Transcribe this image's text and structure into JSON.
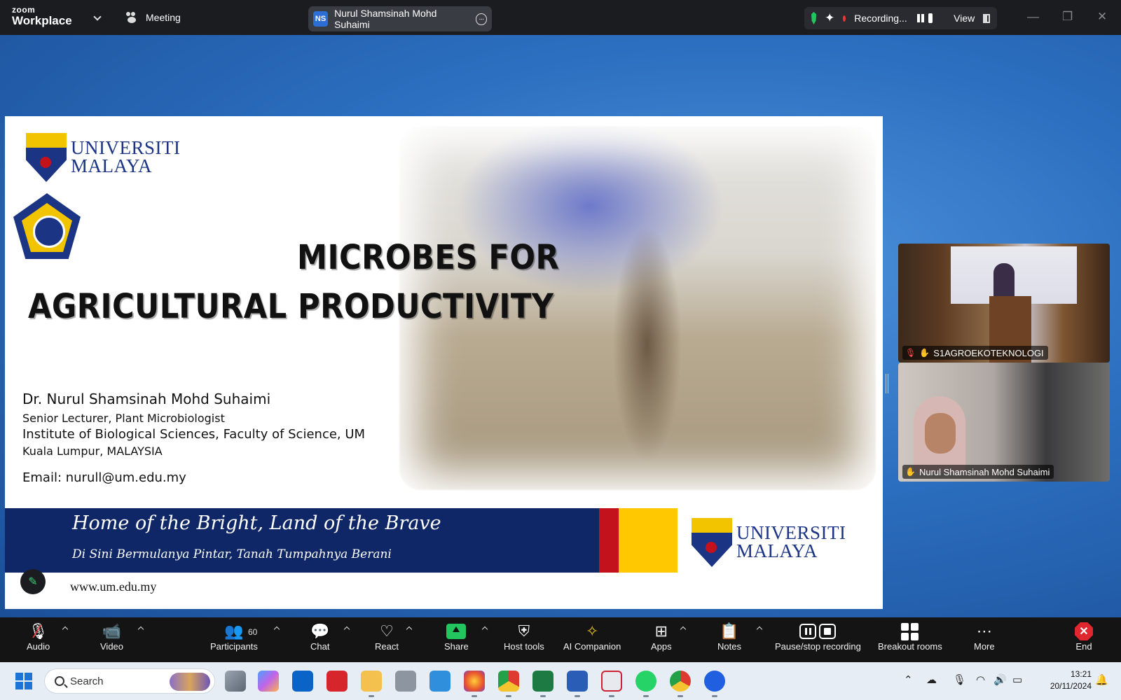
{
  "titlebar": {
    "brand_top": "zoom",
    "brand_bottom": "Workplace",
    "meeting_label": "Meeting",
    "active_speaker_initials": "NS",
    "active_speaker_name": "Nurul Shamsinah Mohd Suhaimi",
    "recording_label": "Recording...",
    "view_label": "View"
  },
  "slide": {
    "logo_line1": "UNIVERSITI",
    "logo_line2": "MALAYA",
    "title_line1": "MICROBES FOR",
    "title_line2": "AGRICULTURAL PRODUCTIVITY",
    "presenter_name": "Dr. Nurul Shamsinah Mohd Suhaimi",
    "presenter_role": "Senior Lecturer, Plant Microbiologist",
    "presenter_institute": "Institute of Biological Sciences, Faculty of Science, UM",
    "presenter_location": "Kuala Lumpur, MALAYSIA",
    "presenter_email": "Email: nurull@um.edu.my",
    "motto_en": "Home of the Bright, Land of the Brave",
    "motto_ms": "Di Sini Bermulanya Pintar, Tanah Tumpahnya Berani",
    "website": "www.um.edu.my",
    "colors": {
      "navy": "#0f2766",
      "red": "#c4121c",
      "yellow": "#ffc800"
    }
  },
  "participants_tiles": [
    {
      "name": "S1AGROEKOTEKNOLOGI",
      "muted": true
    },
    {
      "name": "Nurul Shamsinah Mohd Suhaimi",
      "muted": false
    }
  ],
  "toolbar": {
    "audio": "Audio",
    "video": "Video",
    "participants": "Participants",
    "participants_count": "60",
    "chat": "Chat",
    "react": "React",
    "share": "Share",
    "host_tools": "Host tools",
    "ai_companion": "AI Companion",
    "apps": "Apps",
    "notes": "Notes",
    "pause_stop_recording": "Pause/stop recording",
    "breakout_rooms": "Breakout rooms",
    "more": "More",
    "end": "End"
  },
  "taskbar": {
    "search_placeholder": "Search",
    "time": "13:21",
    "date": "20/11/2024"
  }
}
